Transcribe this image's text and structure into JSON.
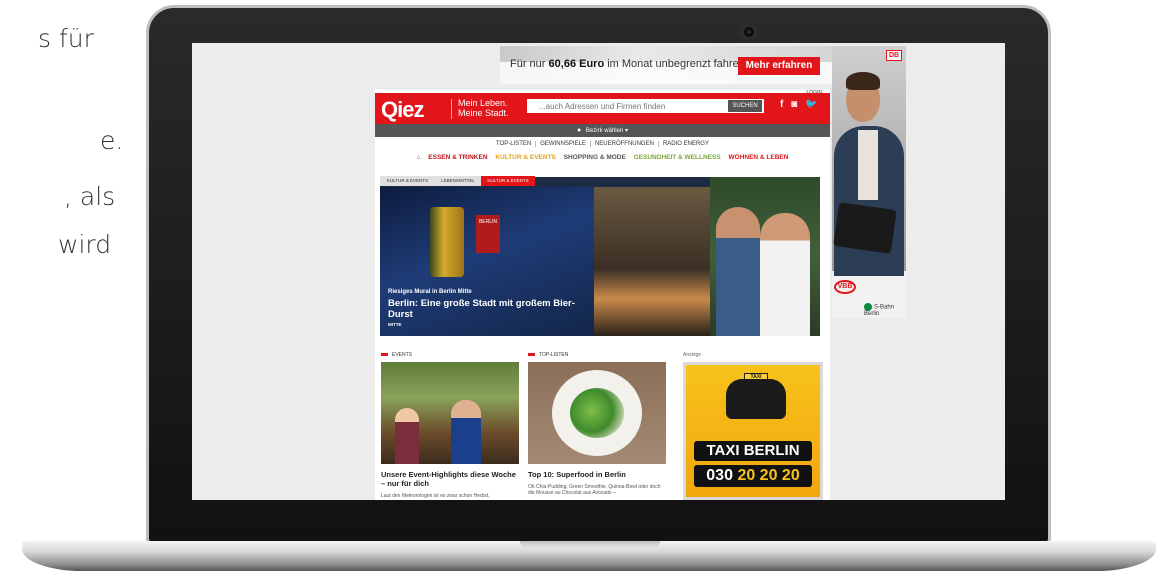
{
  "slide_text": {
    "line1": "s für",
    "line2": "e.",
    "line3": ", als",
    "line4": "wird"
  },
  "browser": {
    "top_ad": {
      "text_prefix": "Für nur",
      "text_price": "60,66 Euro",
      "text_suffix": "im Monat unbegrenzt fahren.",
      "button": "Mehr erfahren"
    },
    "side_ad": {
      "db_logo": "DB",
      "vbb_logo": "VBB",
      "sbahn": "S-Bahn Berlin"
    }
  },
  "site": {
    "login": "LOGIN",
    "logo": "Qiez",
    "slogan_line1": "Mein Leben.",
    "slogan_line2": "Meine Stadt.",
    "search_placeholder": "...auch Adressen und Firmen finden",
    "search_button": "SUCHEN",
    "social": {
      "facebook": "f",
      "instagram": "◙",
      "twitter": "🐦"
    },
    "bezirk": "Bezirk wählen",
    "nav_top": [
      "TOP-LISTEN",
      "GEWINNSPIELE",
      "NEUERÖFFNUNGEN",
      "RADIO ENERGY"
    ],
    "nav_categories": [
      {
        "label": "ESSEN & TRINKEN",
        "color": "#c0141a"
      },
      {
        "label": "KULTUR & EVENTS",
        "color": "#e0a21a"
      },
      {
        "label": "SHOPPING & MODE",
        "color": "#555555"
      },
      {
        "label": "GESUNDHEIT & WELLNESS",
        "color": "#7aa63a"
      },
      {
        "label": "WOHNEN & LEBEN",
        "color": "#e2151b"
      }
    ],
    "hero_tabs": [
      "KULTUR & EVENTS",
      "LEBENSMITTEL",
      "KULTUR & EVENTS"
    ],
    "hero": {
      "kicker": "Riesiges Mural in Berlin Mitte",
      "title": "Berlin: Eine große Stadt mit großem Bier-Durst",
      "district": "MITTE",
      "beer_sign": "BERLIN"
    },
    "events": {
      "label": "EVENTS",
      "title": "Unsere Event-Highlights diese Woche – nur für dich",
      "teaser": "Laut den Meteorologen ist es zwar schon Herbst,"
    },
    "toplisten": {
      "label": "TOP-LISTEN",
      "title": "Top 10: Superfood in Berlin",
      "teaser": "Ob Chia-Pudding, Green Smoothie, Quinoa-Bowl oder doch die Mousse au Chocolat aus Avocado –"
    },
    "ad": {
      "label": "Anzeige",
      "taxi_sign": "TAXI",
      "taxi_name": "TAXI BERLIN",
      "phone_prefix": "030",
      "phone_rest": "20 20 20"
    }
  },
  "colors": {
    "brand_red": "#e2151b",
    "taxi_yellow": "#f7c21a"
  }
}
